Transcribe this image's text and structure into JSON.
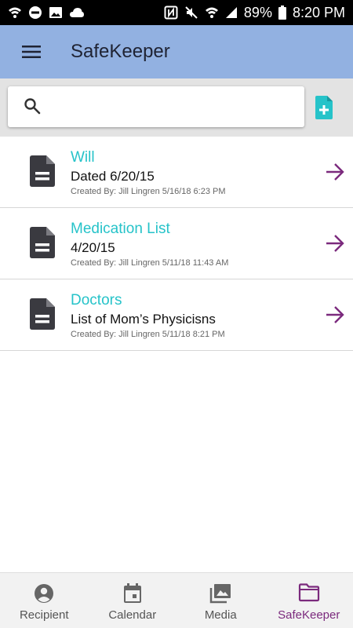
{
  "status_bar": {
    "battery": "89%",
    "time": "8:20 PM"
  },
  "app_bar": {
    "title": "SafeKeeper"
  },
  "search": {
    "value": "",
    "placeholder": ""
  },
  "documents": [
    {
      "title": "Will",
      "subtitle": "Dated 6/20/15",
      "meta": "Created By: Jill Lingren 5/16/18 6:23 PM"
    },
    {
      "title": "Medication List",
      "subtitle": "4/20/15",
      "meta": "Created By: Jill Lingren 5/11/18 11:43 AM"
    },
    {
      "title": "Doctors",
      "subtitle": "List of Mom’s Physicisns",
      "meta": "Created By: Jill Lingren 5/11/18 8:21 PM"
    }
  ],
  "bottom_nav": {
    "items": [
      {
        "label": "Recipient",
        "icon": "account-circle-icon"
      },
      {
        "label": "Calendar",
        "icon": "calendar-icon"
      },
      {
        "label": "Media",
        "icon": "photo-library-icon"
      },
      {
        "label": "SafeKeeper",
        "icon": "folder-icon"
      }
    ],
    "active": "SafeKeeper"
  },
  "colors": {
    "app_bar": "#92b1e1",
    "accent_teal": "#26c3c9",
    "accent_purple": "#7b2a7d",
    "doc_icon": "#3a3a40"
  }
}
